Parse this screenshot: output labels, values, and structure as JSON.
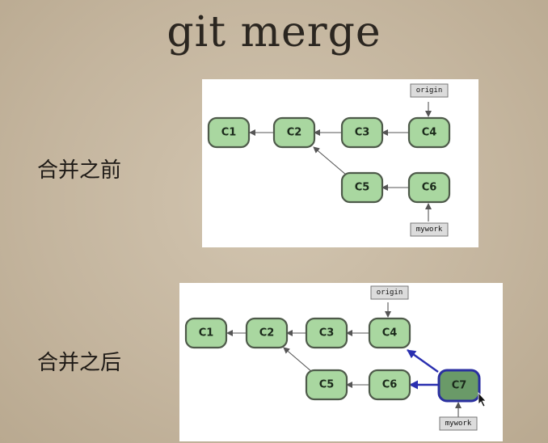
{
  "title": "git merge",
  "before": {
    "label": "合并之前",
    "commits": [
      "C1",
      "C2",
      "C3",
      "C4",
      "C5",
      "C6"
    ],
    "refs": {
      "origin": "origin",
      "mywork": "mywork"
    }
  },
  "after": {
    "label": "合并之后",
    "commits": [
      "C1",
      "C2",
      "C3",
      "C4",
      "C5",
      "C6",
      "C7"
    ],
    "refs": {
      "origin": "origin",
      "mywork": "mywork"
    }
  },
  "colors": {
    "commit_fill": "#a9d7a0",
    "merge_fill": "#6a9a68",
    "merge_edge": "#2a2fb0"
  }
}
